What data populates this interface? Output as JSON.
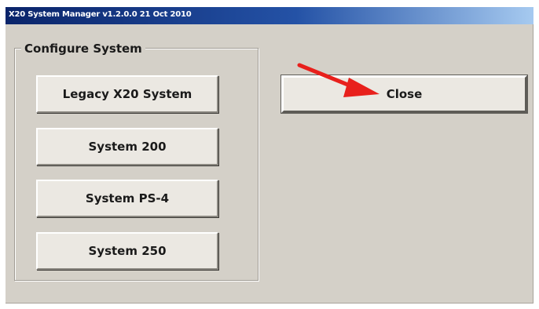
{
  "window": {
    "title": "X20 System Manager  v1.2.0.0   21 Oct 2010"
  },
  "configure_group": {
    "label": "Configure System",
    "buttons": [
      "Legacy X20 System",
      "System 200",
      "System PS-4",
      "System 250"
    ]
  },
  "close_button": {
    "label": "Close"
  },
  "annotation": {
    "arrow_color": "#e8201c"
  },
  "colors": {
    "window_bg": "#d4d0c8",
    "titlebar_start": "#0a246a",
    "titlebar_end": "#a6caf0"
  }
}
